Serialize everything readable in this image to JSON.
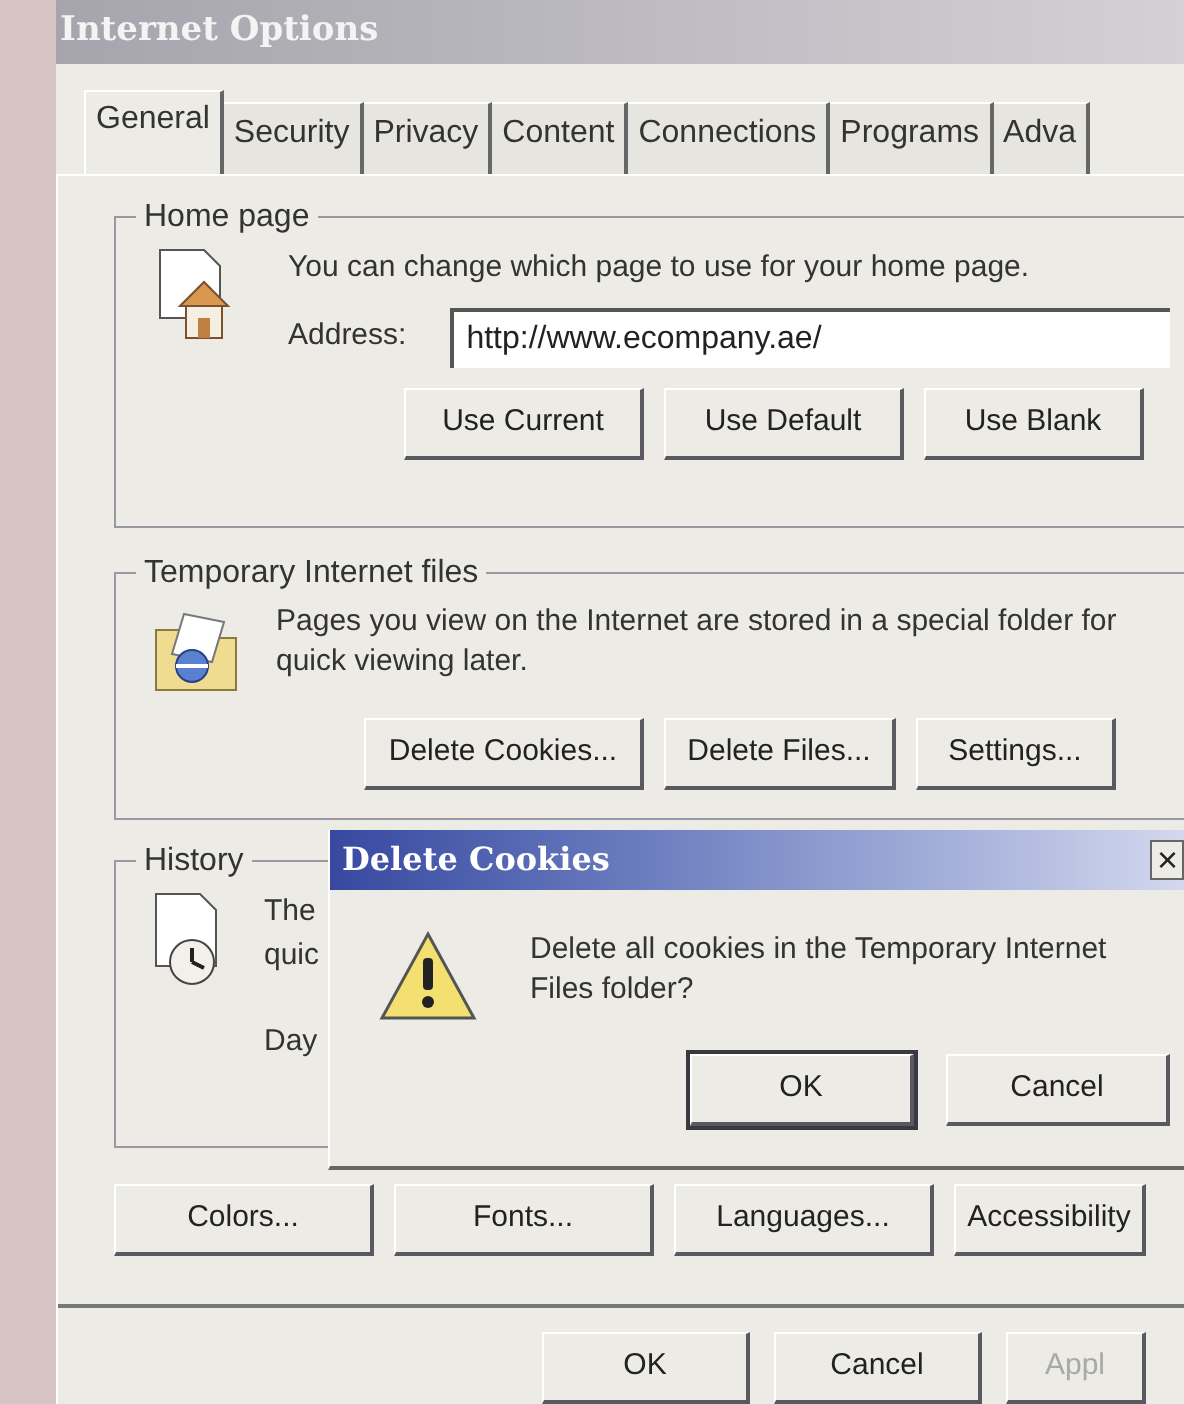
{
  "window": {
    "title": "Internet Options"
  },
  "tabs": [
    {
      "label": "General",
      "selected": true
    },
    {
      "label": "Security",
      "selected": false
    },
    {
      "label": "Privacy",
      "selected": false
    },
    {
      "label": "Content",
      "selected": false
    },
    {
      "label": "Connections",
      "selected": false
    },
    {
      "label": "Programs",
      "selected": false
    },
    {
      "label": "Adva",
      "selected": false
    }
  ],
  "home_page": {
    "title": "Home page",
    "description": "You can change which page to use for your home page.",
    "address_label": "Address:",
    "address_value": "http://www.ecompany.ae/",
    "buttons": [
      "Use Current",
      "Use Default",
      "Use Blank"
    ]
  },
  "temporary_files": {
    "title": "Temporary Internet files",
    "description": "Pages you view on the Internet are stored in a special folder for quick viewing later.",
    "buttons": [
      "Delete Cookies...",
      "Delete Files...",
      "Settings..."
    ]
  },
  "history": {
    "title": "History",
    "lines": [
      "The",
      "quic"
    ],
    "days_label": "Day"
  },
  "bottom_buttons": [
    "Colors...",
    "Fonts...",
    "Languages...",
    "Accessibility"
  ],
  "dialog_buttons": [
    {
      "label": "OK",
      "disabled": false
    },
    {
      "label": "Cancel",
      "disabled": false
    },
    {
      "label": "Appl",
      "disabled": true
    }
  ],
  "confirm": {
    "title": "Delete Cookies",
    "close": "×",
    "message": "Delete all cookies in the Temporary Internet Files folder?",
    "buttons": [
      {
        "label": "OK",
        "default": true
      },
      {
        "label": "Cancel",
        "default": false
      }
    ]
  }
}
